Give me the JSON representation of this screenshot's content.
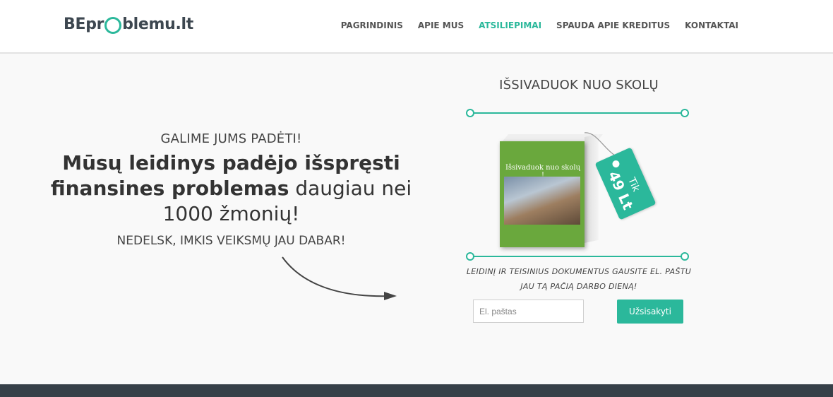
{
  "header": {
    "logo": {
      "prefix": "BEpr",
      "suffix": "blemu.lt"
    },
    "nav": [
      {
        "label": "PAGRINDINIS",
        "active": false
      },
      {
        "label": "APIE MUS",
        "active": false
      },
      {
        "label": "ATSILIEPIMAI",
        "active": true
      },
      {
        "label": "SPAUDA APIE KREDITUS",
        "active": false
      },
      {
        "label": "KONTAKTAI",
        "active": false
      }
    ]
  },
  "hero": {
    "kicker": "GALIME JUMS PADĖTI!",
    "headline_bold": "Mūsų leidinys padėjo išspręsti finansines problemas",
    "headline_rest": " daugiau nei 1000 žmonių!",
    "cta_text": "NEDELSK, IMKIS VEIKSMŲ JAU DABAR!"
  },
  "offer": {
    "title": "IŠSIVADUOK NUO SKOLŲ",
    "book": {
      "title": "Išsivaduok nuo skolų !"
    },
    "tag": {
      "tik": "Tik",
      "price": "49 Lt"
    },
    "note": "LEIDINĮ IR TEISINIUS DOKUMENTUS GAUSITE EL. PAŠTU JAU TĄ PAČIĄ DARBO DIENĄ!",
    "email_placeholder": "El. paštas",
    "subscribe_label": "Užsisakyti"
  },
  "colors": {
    "accent": "#2bb89b",
    "footer": "#364048",
    "book_green": "#6aa83d"
  }
}
